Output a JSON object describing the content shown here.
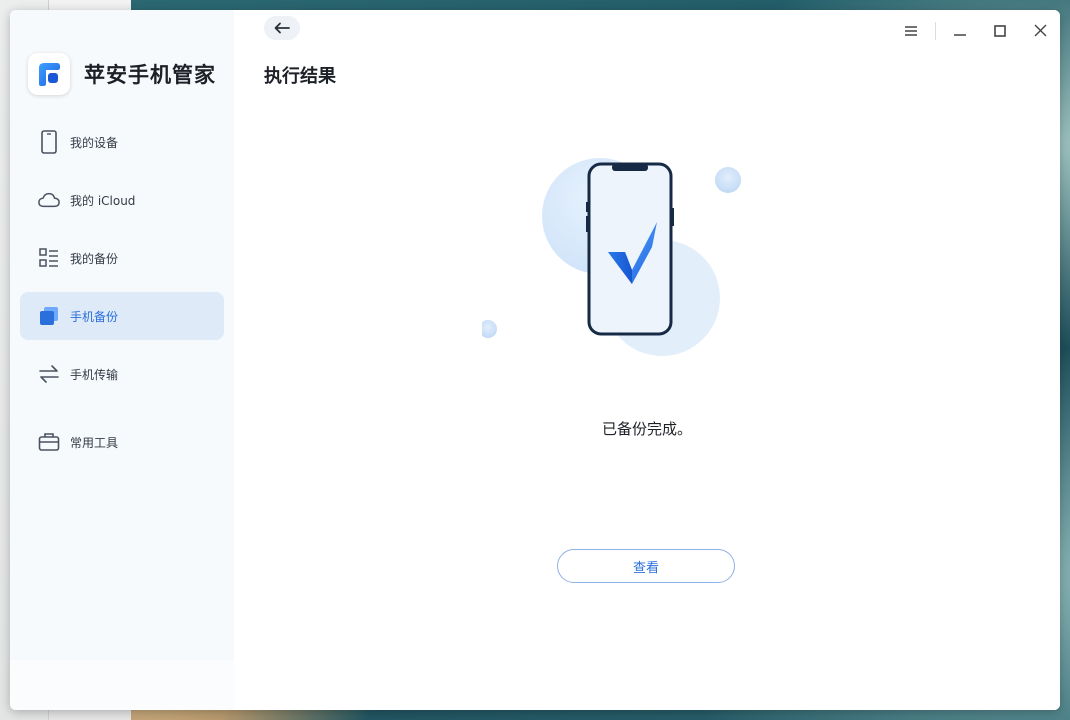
{
  "app": {
    "name": "苹安手机管家"
  },
  "sidebar": {
    "items": [
      {
        "label": "我的设备",
        "icon": "phone-device-icon",
        "active": false
      },
      {
        "label": "我的 iCloud",
        "icon": "cloud-icon",
        "active": false
      },
      {
        "label": "我的备份",
        "icon": "backup-list-icon",
        "active": false
      },
      {
        "label": "手机备份",
        "icon": "phone-backup-icon",
        "active": true
      },
      {
        "label": "手机传输",
        "icon": "transfer-arrows-icon",
        "active": false
      },
      {
        "label": "常用工具",
        "icon": "toolbox-icon",
        "active": false
      }
    ]
  },
  "header": {
    "title": "执行结果"
  },
  "result": {
    "message": "已备份完成。",
    "view_button": "查看"
  },
  "colors": {
    "accent": "#2a6fdb",
    "active_bg": "#dfeaf9",
    "sidebar_bg": "#f7fafd"
  }
}
